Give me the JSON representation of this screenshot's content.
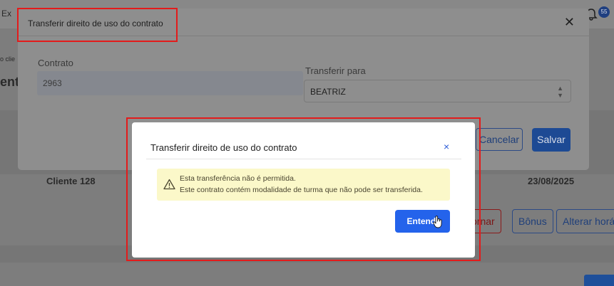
{
  "background": {
    "topbar_left_text": "Ex",
    "side_text_top": "o clie",
    "side_text_mid": "ent",
    "client_name": "Cliente 128",
    "date": "23/08/2025",
    "buttons": {
      "retornar": "ornar",
      "bonus": "Bônus",
      "alterar_horario": "Alterar horá"
    },
    "notification_count": "55"
  },
  "modal_contract": {
    "title": "Transferir direito de uso do contrato",
    "contract_label": "Contrato",
    "contract_value": "2963",
    "transfer_label": "Transferir para",
    "transfer_value": "BEATRIZ",
    "cancel_label": "Cancelar",
    "save_label": "Salvar"
  },
  "dialog": {
    "title": "Transferir direito de uso do contrato",
    "close_glyph": "×",
    "alert_line1": "Esta transferência não é permitida.",
    "alert_line2": "Este contrato contém modalidade de turma que não pode ser transferida.",
    "ok_label": "Entendi"
  },
  "colors": {
    "primary": "#2463eb",
    "alert_bg": "#fbf8c9",
    "highlight": "#e31b1b"
  }
}
